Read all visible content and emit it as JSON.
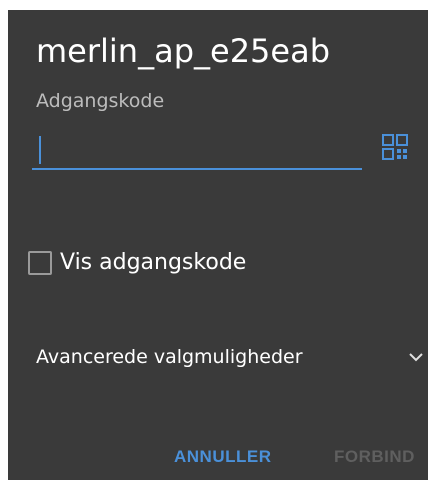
{
  "dialog": {
    "title": "merlin_ap_e25eab",
    "password_label": "Adgangskode",
    "password_value": "",
    "show_password_label": "Vis adgangskode",
    "show_password_checked": false,
    "advanced_label": "Avancerede valgmuligheder",
    "cancel_label": "ANNULLER",
    "connect_label": "FORBIND",
    "connect_enabled": false
  },
  "icons": {
    "scan": "qr-code-icon",
    "advanced": "chevron-down-icon"
  },
  "colors": {
    "background": "#3a3a3a",
    "accent": "#4a90d9",
    "disabled": "#5f5f5f"
  }
}
